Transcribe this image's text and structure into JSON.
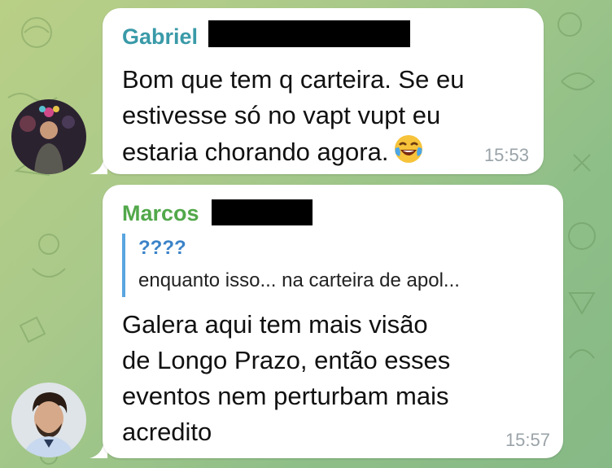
{
  "messages": [
    {
      "sender": "Gabriel",
      "sender_color": "#3a9aa8",
      "lines": [
        "Bom que tem q carteira. Se eu",
        "estivesse só no vapt vupt eu",
        "estaria chorando agora."
      ],
      "emoji": "face-with-tears-of-joy",
      "time": "15:53"
    },
    {
      "sender": "Marcos",
      "sender_color": "#52a84a",
      "reply": {
        "title": "????",
        "text": "enquanto isso... na carteira de apol..."
      },
      "lines": [
        "Galera aqui tem mais visão",
        "de Longo Prazo, então esses",
        "eventos nem perturbam mais",
        "acredito"
      ],
      "time": "15:57"
    }
  ]
}
